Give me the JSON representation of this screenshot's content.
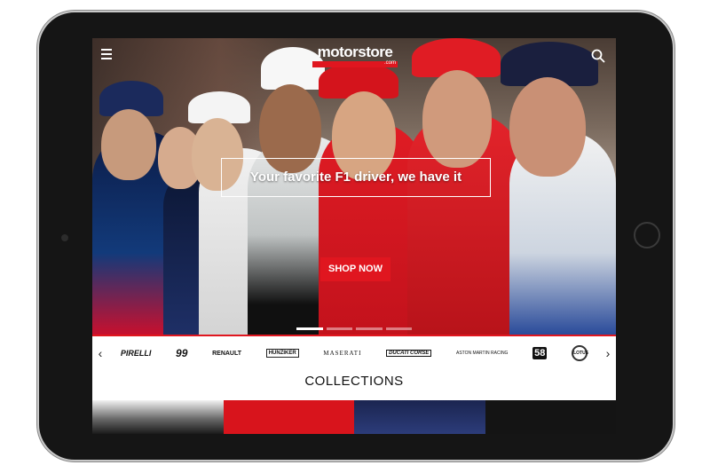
{
  "header": {
    "menu_icon": "hamburger-menu-icon",
    "logo_text": "motorstore",
    "logo_suffix": ".com",
    "search_icon": "search-icon"
  },
  "hero": {
    "tagline": "Your favorite F1 driver, we have it",
    "cta_label": "SHOP NOW",
    "slide_count": 4,
    "active_slide": 1
  },
  "brands": {
    "prev_icon": "chevron-left-icon",
    "next_icon": "chevron-right-icon",
    "items": [
      {
        "label": "PIRELLI"
      },
      {
        "label": "99"
      },
      {
        "label": "RENAULT"
      },
      {
        "label": "HUNZIKER"
      },
      {
        "label": "MASERATI"
      },
      {
        "label": "DUCATI CORSE"
      },
      {
        "label": "ASTON MARTIN RACING"
      },
      {
        "label": "58"
      },
      {
        "label": "LOTUS"
      }
    ]
  },
  "collections": {
    "title": "COLLECTIONS"
  },
  "colors": {
    "accent": "#e0161f",
    "text": "#111111",
    "device": "#151515"
  }
}
